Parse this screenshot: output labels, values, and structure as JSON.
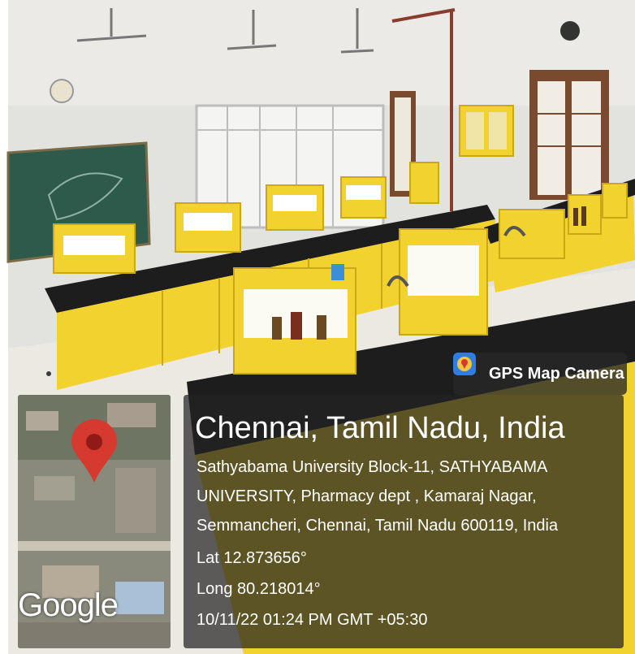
{
  "overlay": {
    "badge": {
      "label": "GPS Map Camera",
      "icon": "gps-map-camera-icon"
    },
    "map": {
      "logo_text": "Google",
      "pin_color": "#d63a2f"
    },
    "location": {
      "title": "Chennai, Tamil Nadu, India",
      "address_lines": [
        "Sathyabama University Block-11, SATHYABAMA",
        "UNIVERSITY, Pharmacy dept , Kamaraj Nagar,",
        "Semmancheri, Chennai, Tamil Nadu 600119, India"
      ],
      "lat": "Lat 12.873656°",
      "long": "Long 80.218014°",
      "datetime": "10/11/22 01:24 PM GMT +05:30"
    }
  },
  "colors": {
    "lab_yellow": "#f2d22e",
    "bench_top": "#1d1d1d",
    "chalkboard": "#2e5a4c",
    "wall": "#e6e6e6"
  }
}
